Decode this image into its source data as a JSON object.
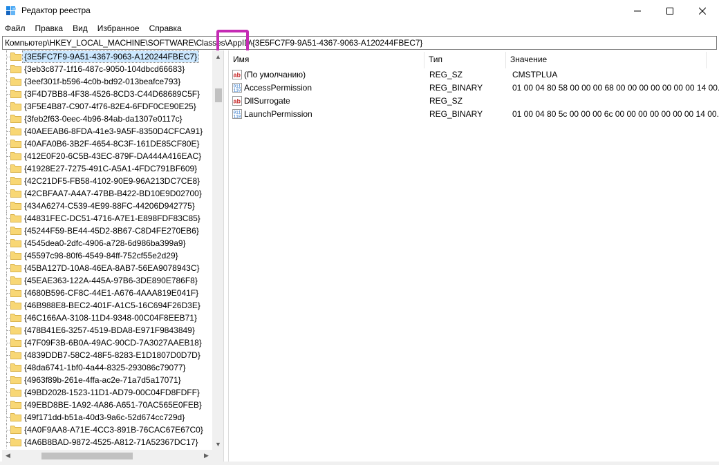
{
  "window": {
    "title": "Редактор реестра",
    "controls": {
      "minimize": "—",
      "maximize": "☐",
      "close": "✕"
    }
  },
  "menu": [
    "Файл",
    "Правка",
    "Вид",
    "Избранное",
    "Справка"
  ],
  "address": {
    "path": "Компьютер\\HKEY_LOCAL_MACHINE\\SOFTWARE\\Classes\\AppID\\{3E5FC7F9-9A51-4367-9063-A120244FBEC7}"
  },
  "tree": {
    "items": [
      "{3E5FC7F9-9A51-4367-9063-A120244FBEC7}",
      "{3eb3c877-1f16-487c-9050-104dbcd66683}",
      "{3eef301f-b596-4c0b-bd92-013beafce793}",
      "{3F4D7BB8-4F38-4526-8CD3-C44D68689C5F}",
      "{3F5E4B87-C907-4f76-82E4-6FDF0CE90E25}",
      "{3feb2f63-0eec-4b96-84ab-da1307e0117c}",
      "{40AEEAB6-8FDA-41e3-9A5F-8350D4CFCA91}",
      "{40AFA0B6-3B2F-4654-8C3F-161DE85CF80E}",
      "{412E0F20-6C5B-43EC-879F-DA444A416EAC}",
      "{41928E27-7275-491C-A5A1-4FDC791BF609}",
      "{42C21DF5-FB58-4102-90E9-96A213DC7CE8}",
      "{42CBFAA7-A4A7-47BB-B422-BD10E9D02700}",
      "{434A6274-C539-4E99-88FC-44206D942775}",
      "{44831FEC-DC51-4716-A7E1-E898FDF83C85}",
      "{45244F59-BE44-45D2-8B67-C8D4FE270EB6}",
      "{4545dea0-2dfc-4906-a728-6d986ba399a9}",
      "{45597c98-80f6-4549-84ff-752cf55e2d29}",
      "{45BA127D-10A8-46EA-8AB7-56EA9078943C}",
      "{45EAE363-122A-445A-97B6-3DE890E786F8}",
      "{4680B596-CF8C-44E1-A676-4AAA819E041F}",
      "{46B988E8-BEC2-401F-A1C5-16C694F26D3E}",
      "{46C166AA-3108-11D4-9348-00C04F8EEB71}",
      "{478B41E6-3257-4519-BDA8-E971F9843849}",
      "{47F09F3B-6B0A-49AC-90CD-7A3027AAEB18}",
      "{4839DDB7-58C2-48F5-8283-E1D1807D0D7D}",
      "{48da6741-1bf0-4a44-8325-293086c79077}",
      "{4963f89b-261e-4ffa-ac2e-71a7d5a17071}",
      "{49BD2028-1523-11D1-AD79-00C04FD8FDFF}",
      "{49EBD8BE-1A92-4A86-A651-70AC565E0FEB}",
      "{49f171dd-b51a-40d3-9a6c-52d674cc729d}",
      "{4A0F9AA8-A71E-4CC3-891B-76CAC67E67C0}",
      "{4A6B8BAD-9872-4525-A812-71A52367DC17}"
    ]
  },
  "values": {
    "columns": {
      "name": "Имя",
      "type": "Тип",
      "data": "Значение"
    },
    "rows": [
      {
        "icon": "string-value-icon",
        "name": "(По умолчанию)",
        "type": "REG_SZ",
        "data": "CMSTPLUA"
      },
      {
        "icon": "binary-value-icon",
        "name": "AccessPermission",
        "type": "REG_BINARY",
        "data": "01 00 04 80 58 00 00 00 68 00 00 00 00 00 00 00 14 00..."
      },
      {
        "icon": "string-value-icon",
        "name": "DllSurrogate",
        "type": "REG_SZ",
        "data": ""
      },
      {
        "icon": "binary-value-icon",
        "name": "LaunchPermission",
        "type": "REG_BINARY",
        "data": "01 00 04 80 5c 00 00 00 6c 00 00 00 00 00 00 00 14 00..."
      }
    ]
  },
  "colors": {
    "selection": "#cce8ff",
    "highlight_box": "#c52bb4",
    "folder": "#f8d775"
  }
}
